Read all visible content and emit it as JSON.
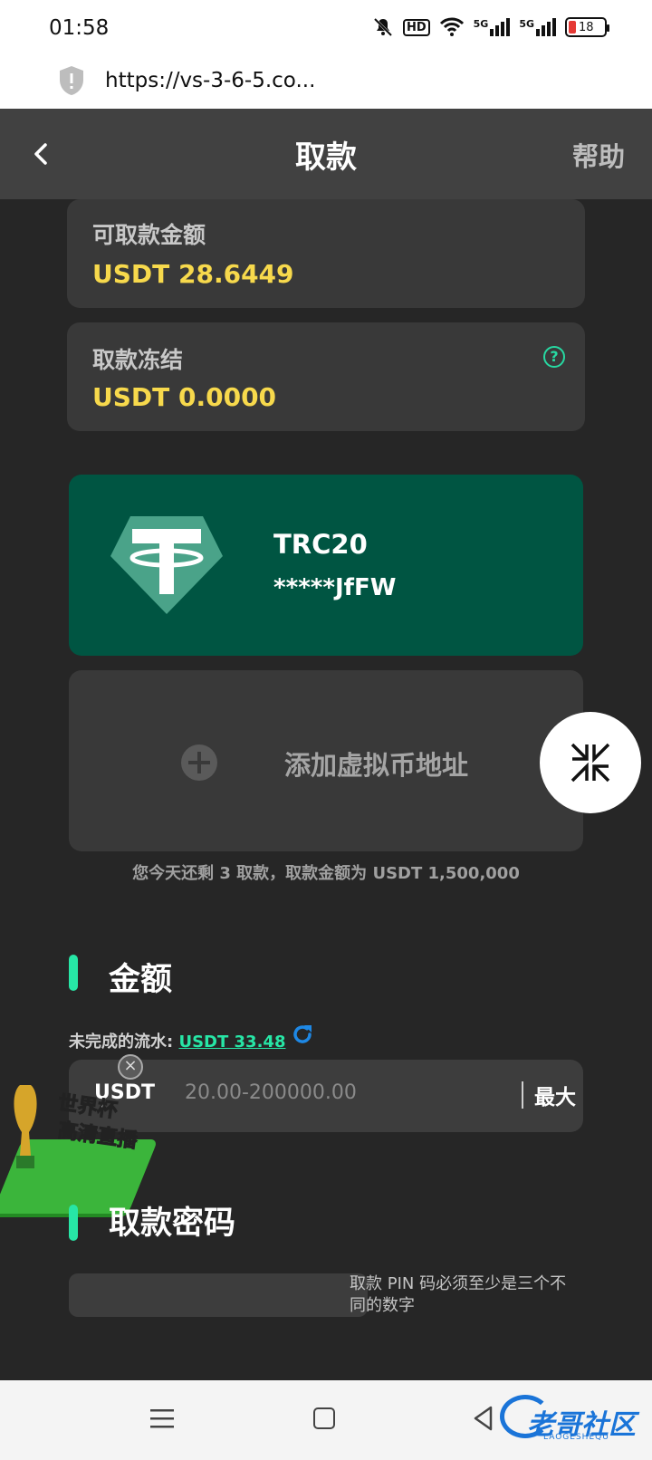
{
  "status_bar": {
    "time": "01:58",
    "network1": "5G",
    "network2": "5G",
    "hd": "HD",
    "battery": "18"
  },
  "browser": {
    "url": "https://vs-3-6-5.co..."
  },
  "header": {
    "title": "取款",
    "help": "帮助"
  },
  "available": {
    "label": "可取款金额",
    "value": "USDT 28.6449"
  },
  "frozen": {
    "label": "取款冻结",
    "value": "USDT 0.0000",
    "help_glyph": "?"
  },
  "wallet": {
    "network": "TRC20",
    "address": "*****JfFW"
  },
  "add_address": {
    "label": "添加虚拟币地址"
  },
  "limits_info": "您今天还剩 3 取款，取款金额为 USDT 1,500,000",
  "amount_section": {
    "title": "金额",
    "turnover_label": "未完成的流水: ",
    "turnover_value": "USDT 33.48",
    "currency": "USDT",
    "placeholder": "20.00-200000.00",
    "max_label": "最大"
  },
  "promo": {
    "line1": "世界杯",
    "line2": "高清直播"
  },
  "pin_section": {
    "title": "取款密码",
    "hint": "取款 PIN 码必须至少是三个不同的数字"
  },
  "watermark": {
    "text": "老哥社区",
    "sub": "LAOGESHEQU"
  },
  "colors": {
    "accent": "#27e6a6",
    "gold": "#f7d94c",
    "wallet_bg": "#005542",
    "header_bg": "#414141"
  }
}
